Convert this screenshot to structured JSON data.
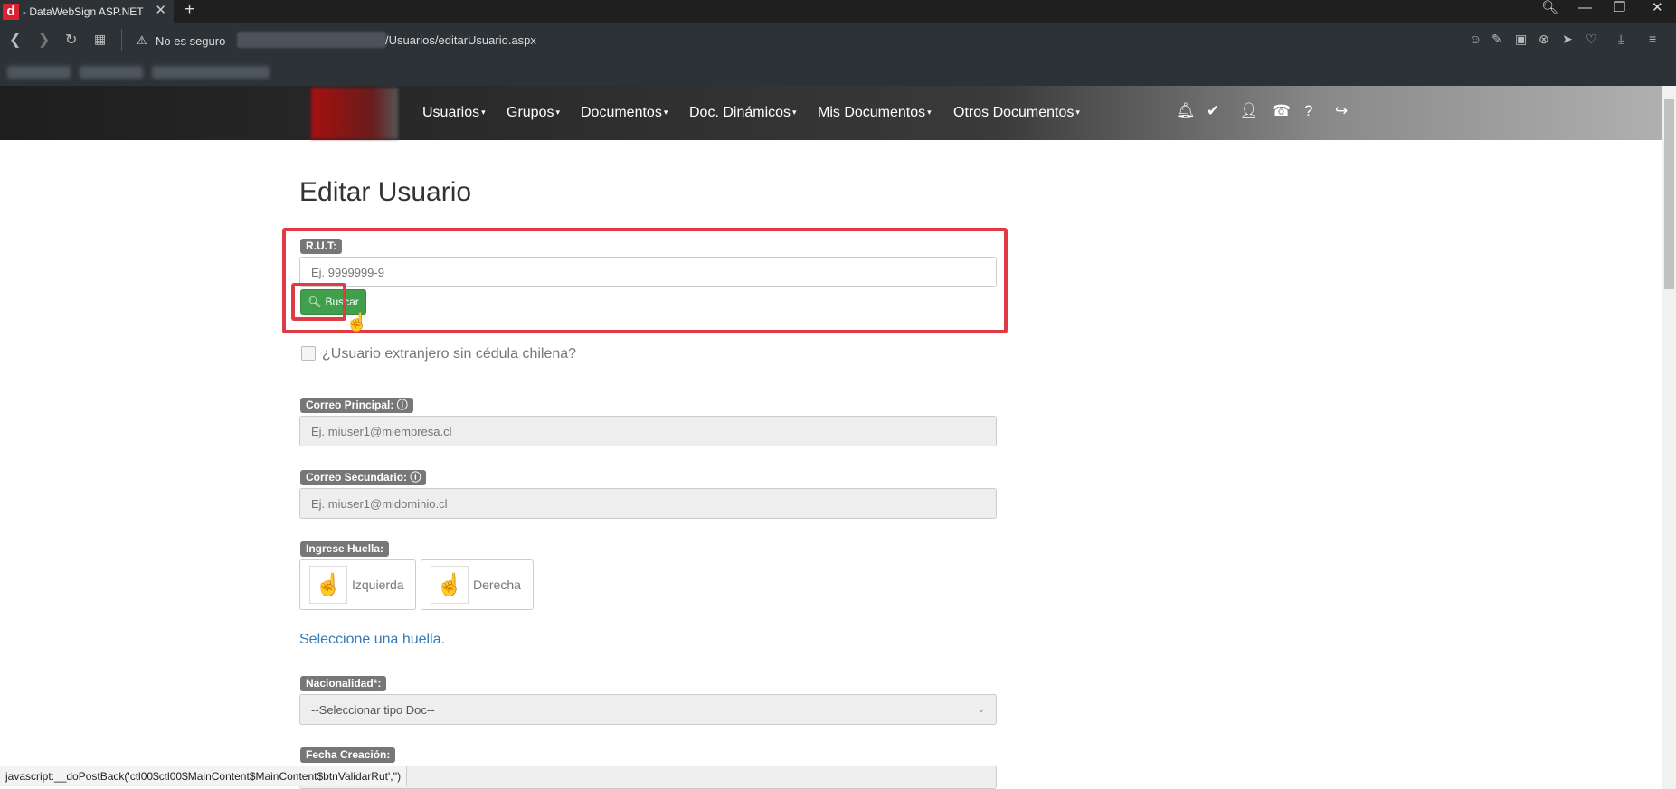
{
  "browser": {
    "tab_title": "- DataWebSign ASP.NET",
    "tab_close": "✕",
    "new_tab": "+",
    "security_label": "No es seguro",
    "url_visible": "/Usuarios/editarUsuario.aspx"
  },
  "site_menu": [
    {
      "label": "Usuarios"
    },
    {
      "label": "Grupos"
    },
    {
      "label": "Documentos"
    },
    {
      "label": "Doc. Dinámicos"
    },
    {
      "label": "Mis Documentos"
    },
    {
      "label": "Otros Documentos"
    }
  ],
  "header_icons": [
    "bell-icon",
    "check-icon",
    "user-icon",
    "phone-icon",
    "help-icon",
    "logout-icon"
  ],
  "page": {
    "title": "Editar Usuario",
    "rut": {
      "label": "R.U.T:",
      "placeholder": "Ej. 9999999-9",
      "button": "Buscar"
    },
    "extranjero_label": "¿Usuario extranjero sin cédula chilena?",
    "correo_principal": {
      "label": "Correo Principal:",
      "placeholder": "Ej. miuser1@miempresa.cl"
    },
    "correo_secundario": {
      "label": "Correo Secundario:",
      "placeholder": "Ej. miuser1@midominio.cl"
    },
    "huella": {
      "label": "Ingrese Huella:",
      "left": "Izquierda",
      "right": "Derecha",
      "prompt": "Seleccione una huella."
    },
    "nacionalidad": {
      "label": "Nacionalidad*:",
      "selected": "--Seleccionar tipo Doc--"
    },
    "fecha_creacion": {
      "label": "Fecha Creación:"
    }
  },
  "status_bar": "javascript:__doPostBack('ctl00$ctl00$MainContent$MainContent$btnValidarRut','')",
  "colors": {
    "accent_green": "#3f9f4a",
    "highlight_red": "#e03a45",
    "link_blue": "#337ab7"
  }
}
